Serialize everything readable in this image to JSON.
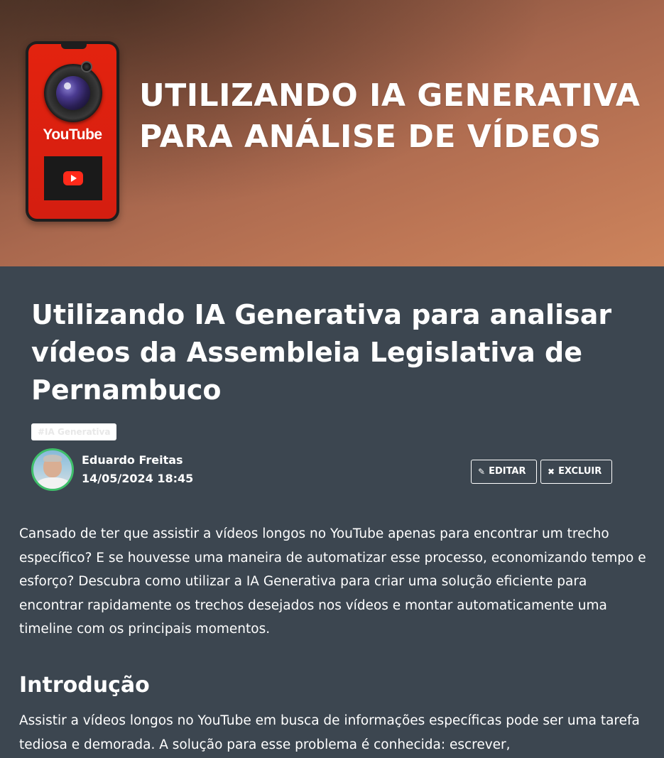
{
  "hero": {
    "title_line1": "UTILIZANDO IA GENERATIVA",
    "title_line2": "PARA ANÁLISE DE VÍDEOS",
    "phone_label": "YouTube"
  },
  "post": {
    "title": "Utilizando IA Generativa para analisar vídeos da Assembleia Legislativa de Pernambuco",
    "tag": "#IA Generativa",
    "author": "Eduardo Freitas",
    "date": "14/05/2024 18:45"
  },
  "actions": {
    "edit_label": "EDITAR",
    "delete_label": "EXCLUIR",
    "edit_icon": "pencil-icon",
    "delete_icon": "close-icon"
  },
  "body": {
    "lead": "Cansado de ter que assistir a vídeos longos no YouTube apenas para encontrar um trecho específico? E se houvesse uma maneira de automatizar esse processo, economizando tempo e esforço? Descubra como utilizar a IA Generativa para criar uma solução eficiente para encontrar rapidamente os trechos desejados nos vídeos e montar automaticamente uma timeline com os principais momentos.",
    "section_heading": "Introdução",
    "section_text": "Assistir a vídeos longos no YouTube em busca de informações específicas pode ser uma tarefa tediosa e demorada. A solução para esse problema é conhecida: escrever,"
  },
  "colors": {
    "page_bg": "#3c4650",
    "avatar_ring": "#3fbf6a",
    "phone_screen": "#e3230f"
  }
}
